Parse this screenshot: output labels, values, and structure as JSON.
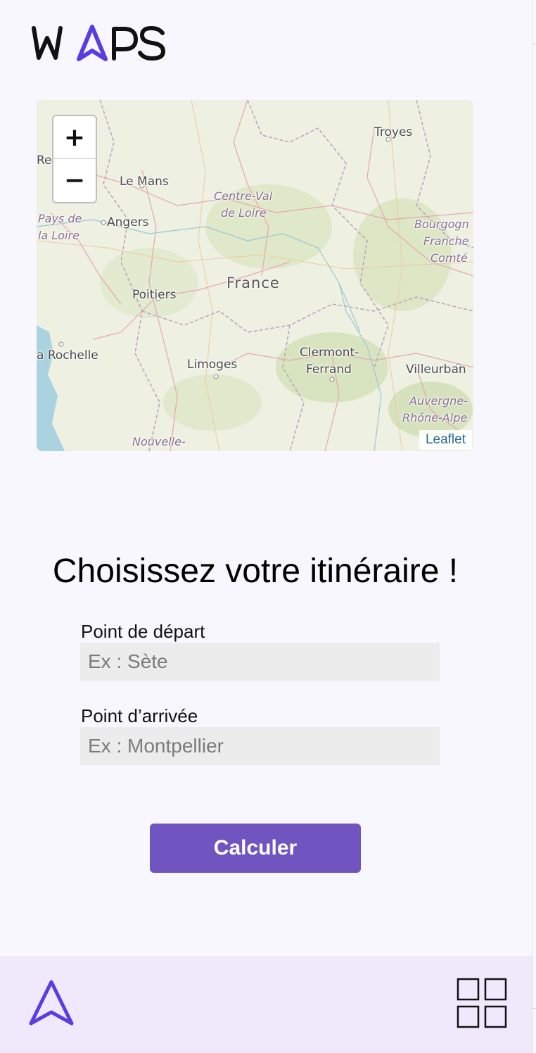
{
  "app": {
    "logo_text": "WAPS",
    "accent_color": "#5a3de0",
    "button_color": "#7054bf"
  },
  "map": {
    "zoom_in_label": "+",
    "zoom_out_label": "−",
    "attribution": "Leaflet",
    "places": {
      "troyes": "Troyes",
      "rennes_partial": "Re",
      "le_mans": "Le Mans",
      "angers": "Angers",
      "poitiers": "Poitiers",
      "la_rochelle_partial": "a Rochelle",
      "limoges": "Limoges",
      "clermont_1": "Clermont-",
      "clermont_2": "Ferrand",
      "villeurbanne_partial": "Villeurban",
      "country": "France",
      "region_cvl_1": "Centre-Val",
      "region_cvl_2": "de Loire",
      "region_pdl_1": "Pays de",
      "region_pdl_2": "la Loire",
      "region_bfc_1": "Bourgogn",
      "region_bfc_2": "Franche",
      "region_bfc_3": "Comté",
      "region_ara_1": "Auvergne-",
      "region_ara_2": "Rhône-Alpe",
      "region_na_partial": "Nouvelle-"
    }
  },
  "form": {
    "heading": "Choisissez votre itinéraire !",
    "departure_label": "Point de départ",
    "departure_placeholder": "Ex : Sète",
    "departure_value": "",
    "arrival_label": "Point d’arrivée",
    "arrival_placeholder": "Ex : Montpellier",
    "arrival_value": "",
    "submit_label": "Calculer"
  },
  "bottom_nav": {
    "items": [
      {
        "icon": "navigation-arrow-icon"
      },
      {
        "icon": "grid-menu-icon"
      }
    ]
  }
}
